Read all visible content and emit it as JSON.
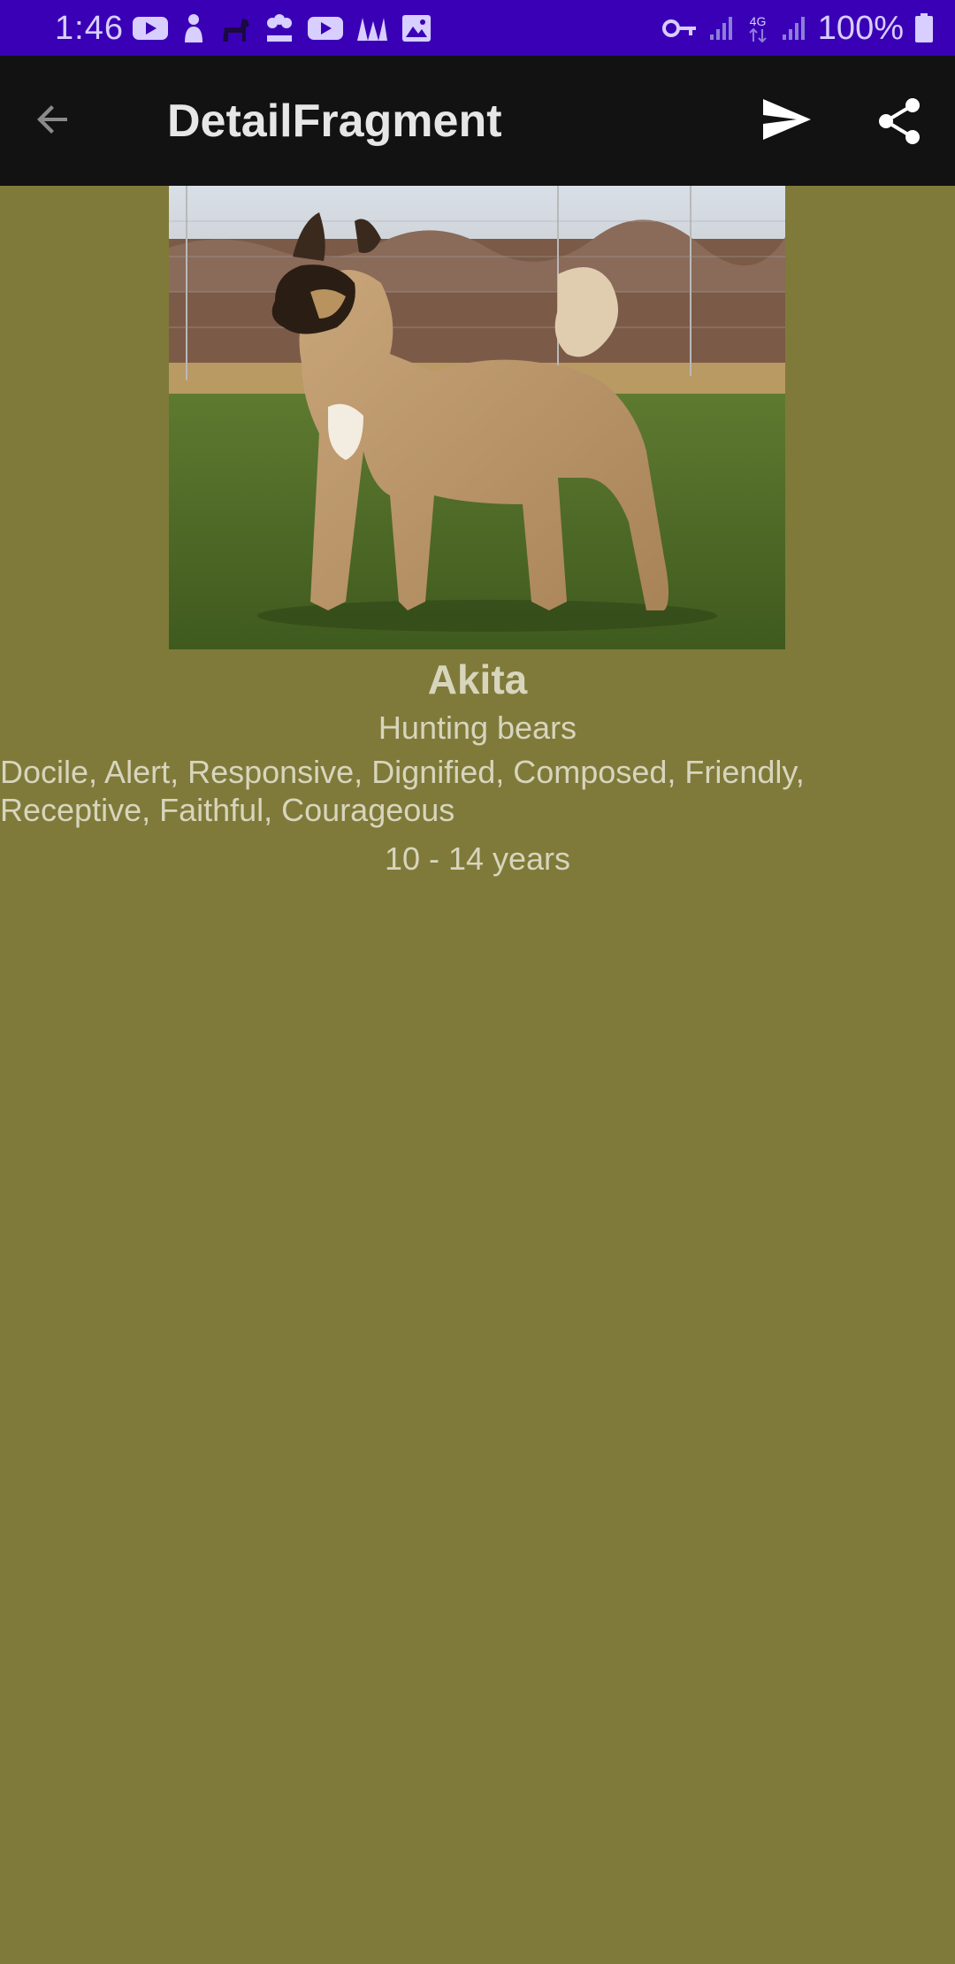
{
  "status_bar": {
    "time": "1:46",
    "battery": "100%",
    "network": "4G",
    "background_color": "#3a00b6"
  },
  "toolbar": {
    "title": "DetailFragment",
    "back_icon": "arrow-back-icon",
    "send_icon": "send-icon",
    "share_icon": "share-icon"
  },
  "detail": {
    "image_subject": "Akita dog standing on grass",
    "name": "Akita",
    "bred_for": "Hunting bears",
    "temperament": "Docile, Alert, Responsive, Dignified, Composed, Friendly, Receptive, Faithful, Courageous",
    "life_span": "10 - 14 years"
  },
  "colors": {
    "page_background": "#7f7a39",
    "toolbar_background": "#121212",
    "text": "#d8d5bd"
  }
}
